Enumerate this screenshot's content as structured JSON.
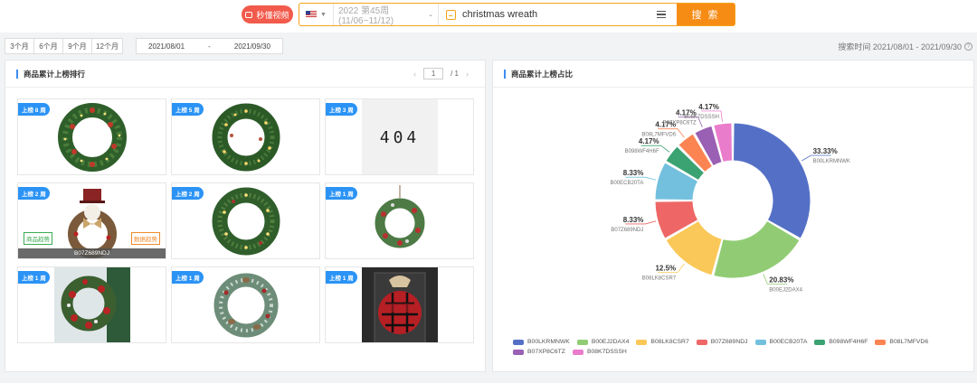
{
  "topbar": {
    "video_btn_label": "秒懂视频",
    "week_select": "2022 第45周 (11/06~11/12)",
    "keyword": "christmas wreath",
    "search_btn": "搜 索"
  },
  "range": {
    "buttons": [
      "3个月",
      "6个月",
      "9个月",
      "12个月"
    ],
    "date_start": "2021/08/01",
    "date_sep": "-",
    "date_end": "2021/09/30",
    "search_time": "搜索时间 2021/08/01 - 2021/09/30"
  },
  "left_panel": {
    "title": "商品累计上榜排行",
    "pager": {
      "current": "1",
      "total": "/ 1"
    },
    "cards": [
      {
        "badge": "上榜 8 周",
        "img": "wreath-lit"
      },
      {
        "badge": "上榜 5 周",
        "img": "wreath-lit"
      },
      {
        "badge": "上榜 3 周",
        "img": "404",
        "text404": "404"
      },
      {
        "badge": "上榜 2 周",
        "img": "wreath-snowman",
        "tag_left": "商品趋势",
        "tag_right": "数据趋势",
        "asin": "B07Z689NDJ"
      },
      {
        "badge": "上榜 2 周",
        "img": "wreath-lit"
      },
      {
        "badge": "上榜 1 周",
        "img": "wreath-red"
      },
      {
        "badge": "上榜 1 周",
        "img": "wreath-red-bg"
      },
      {
        "badge": "上榜 1 周",
        "img": "wreath-frosted"
      },
      {
        "badge": "上榜 1 周",
        "img": "door-sign"
      }
    ]
  },
  "right_panel": {
    "title": "商品累计上榜占比"
  },
  "chart_data": {
    "type": "pie",
    "style": "donut",
    "series": [
      {
        "name": "B00LKRMNWK",
        "value": 33.33,
        "label": "33.33%",
        "color": "#5470c6"
      },
      {
        "name": "B00EJ2DAX4",
        "value": 20.83,
        "label": "20.83%",
        "color": "#91cc75"
      },
      {
        "name": "B08LK8CSR7",
        "value": 12.5,
        "label": "12.5%",
        "color": "#fac858"
      },
      {
        "name": "B07Z689NDJ",
        "value": 8.33,
        "label": "8.33%",
        "color": "#ee6666"
      },
      {
        "name": "B00ECB20TA",
        "value": 8.33,
        "label": "8.33%",
        "color": "#73c0de"
      },
      {
        "name": "B098WF4H6F",
        "value": 4.17,
        "label": "4.17%",
        "color": "#3ba272"
      },
      {
        "name": "B08L7MFVD6",
        "value": 4.17,
        "label": "4.17%",
        "color": "#fc8452"
      },
      {
        "name": "B07XP8C6TZ",
        "value": 4.17,
        "label": "4.17%",
        "color": "#9a60b4"
      },
      {
        "name": "B08K7DSSSH",
        "value": 4.17,
        "label": "4.17%",
        "color": "#ea7ccc"
      }
    ],
    "legend_position": "bottom"
  }
}
